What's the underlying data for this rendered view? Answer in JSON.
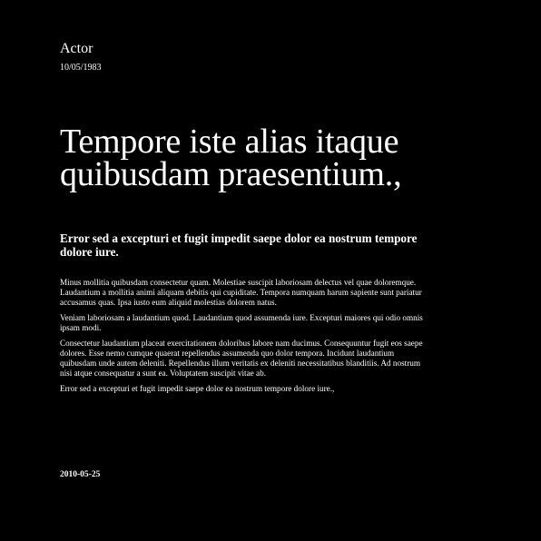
{
  "header": {
    "author": "Actor",
    "date": "10/05/1983"
  },
  "title": "Tempore iste alias itaque quibusdam praesentium.,",
  "subtitle": "Error sed a excepturi et fugit impedit saepe dolor ea nostrum tempore dolore iure.",
  "paragraphs": [
    "Minus mollitia quibusdam consectetur quam. Molestiae suscipit laboriosam delectus vel quae doloremque. Laudantium a mollitia animi aliquam debitis qui cupiditate. Tempora numquam harum sapiente sunt pariatur accusamus quas. Ipsa iusto eum aliquid molestias dolorem natus.",
    "Veniam laboriosam a laudantium quod. Laudantium quod assumenda iure. Excepturi maiores qui odio omnis ipsam modi.",
    "Consectetur laudantium placeat exercitationem doloribus labore nam ducimus. Consequuntur fugit eos saepe dolores. Esse nemo cumque quaerat repellendus assumenda quo dolor tempora. Incidunt laudantium quibusdam unde autem deleniti. Repellendus illum veritatis ex deleniti necessitatibus blanditiis. Ad nostrum nisi atque consequatur a sunt ea. Voluptatem suscipit vitae ab.",
    "Error sed a excepturi et fugit impedit saepe dolor ea nostrum tempore dolore iure.,"
  ],
  "footer": {
    "date": "2010-05-25"
  },
  "colors": {
    "background": "#000000",
    "text": "#ffffff"
  }
}
